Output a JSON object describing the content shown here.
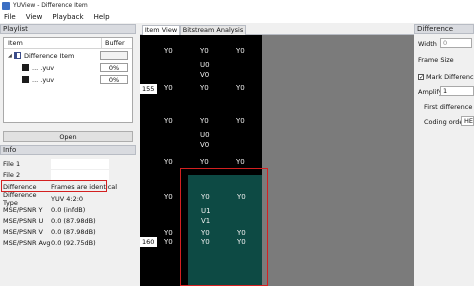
{
  "window": {
    "title": "YUView - Difference Item"
  },
  "menu": [
    "File",
    "View",
    "Playback",
    "Help"
  ],
  "playlist": {
    "title": "Playlist",
    "headers": {
      "item": "Item",
      "buffer": "Buffer"
    },
    "rows": [
      {
        "name": "Difference Item",
        "buffer": ""
      },
      {
        "name": "...                 .yuv",
        "buffer": "0%"
      },
      {
        "name": "...                 .yuv",
        "buffer": "0%"
      }
    ],
    "open_label": "Open"
  },
  "info": {
    "title": "Info",
    "rows": [
      {
        "key": "File 1",
        "value": ""
      },
      {
        "key": "File 2",
        "value": ""
      },
      {
        "key": "Difference",
        "value": "Frames are identical"
      },
      {
        "key": "Difference Type",
        "value": "YUV 4:2:0"
      },
      {
        "key": "MSE/PSNR Y",
        "value": "0.0 (infdB)"
      },
      {
        "key": "MSE/PSNR U",
        "value": "0.0 (87.98dB)"
      },
      {
        "key": "MSE/PSNR V",
        "value": "0.0 (87.98dB)"
      },
      {
        "key": "MSE/PSNR Avg",
        "value": "0.0 (92.75dB)"
      }
    ]
  },
  "tabs": {
    "item_view": "Item View",
    "bitstream": "Bitstream Analysis"
  },
  "view": {
    "row_labels": {
      "top": "155",
      "bottom": "160"
    },
    "y": "Y0",
    "u0": "U0",
    "v0": "V0",
    "u1": "U1",
    "v1": "V1",
    "colors": {
      "teal": "#0d4a44",
      "highlight": "#d32020",
      "background": "#7b7b7b"
    }
  },
  "properties": {
    "title": "Difference Properti",
    "width_label": "Width",
    "width_value": "0",
    "frame_size_label": "Frame Size",
    "mark_label": "Mark Differences",
    "mark_checked": "✓",
    "amplify_label": "Amplify",
    "amplify_value": "1",
    "first_diff_label": "First difference pe",
    "coding_order_label": "Coding order",
    "coding_order_value": "HE"
  }
}
